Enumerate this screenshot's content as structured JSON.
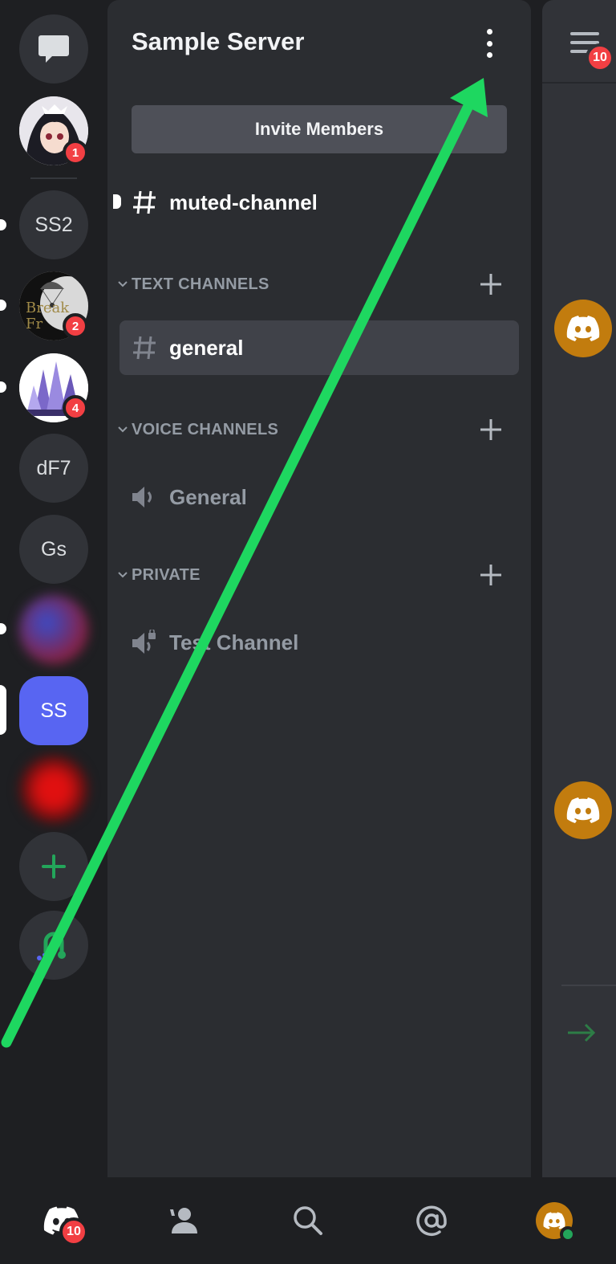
{
  "server": {
    "name": "Sample Server",
    "invite_label": "Invite Members"
  },
  "rail": {
    "servers": [
      {
        "initials": "",
        "badge": "1"
      },
      {
        "initials": "SS2"
      },
      {
        "initials": "",
        "badge": "2",
        "logo_text": "Break Fr"
      },
      {
        "initials": "",
        "badge": "4"
      },
      {
        "initials": "dF7"
      },
      {
        "initials": "Gs"
      },
      {
        "initials": ""
      },
      {
        "initials": "SS"
      },
      {
        "initials": ""
      }
    ]
  },
  "channels": {
    "uncategorized": [
      {
        "name": "muted-channel",
        "type": "text"
      }
    ],
    "categories": [
      {
        "title": "TEXT CHANNELS",
        "channels": [
          {
            "name": "general",
            "type": "text",
            "active": true
          }
        ]
      },
      {
        "title": "VOICE CHANNELS",
        "channels": [
          {
            "name": "General",
            "type": "voice"
          }
        ]
      },
      {
        "title": "PRIVATE",
        "channels": [
          {
            "name": "Test Channel",
            "type": "voice-locked"
          }
        ]
      }
    ]
  },
  "chat": {
    "members_badge": "10"
  },
  "nav": {
    "home_badge": "10",
    "tabs": [
      "home-icon",
      "friends-icon",
      "search-icon",
      "mentions-icon",
      "profile-avatar"
    ]
  },
  "colors": {
    "blurple": "#5865f2",
    "green": "#23a55a",
    "red_badge": "#f23f43",
    "annotation_arrow": "#1ed760"
  }
}
